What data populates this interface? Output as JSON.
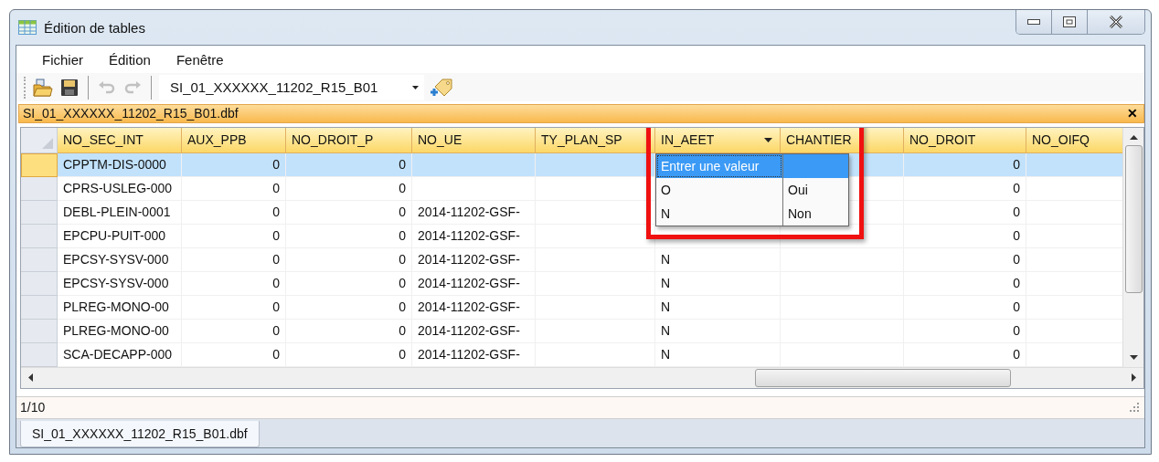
{
  "window": {
    "title": "Édition de tables"
  },
  "menu": [
    {
      "label": "Fichier"
    },
    {
      "label": "Édition"
    },
    {
      "label": "Fenêtre"
    }
  ],
  "toolbar": {
    "buttons": [
      {
        "kind": "open",
        "disabled": false
      },
      {
        "kind": "save",
        "disabled": false
      },
      {
        "kind": "undo",
        "disabled": true
      },
      {
        "kind": "redo",
        "disabled": true
      }
    ],
    "table_select": {
      "value": "SI_01_XXXXXX_11202_R15_B01"
    }
  },
  "document_bar": {
    "title": "SI_01_XXXXXX_11202_R15_B01.dbf",
    "close": "✕"
  },
  "table": {
    "columns": [
      {
        "label": "NO_SEC_INT",
        "kind": "text",
        "filter": false
      },
      {
        "label": "AUX_PPB",
        "kind": "number",
        "filter": false
      },
      {
        "label": "NO_DROIT_P",
        "kind": "number",
        "filter": false
      },
      {
        "label": "NO_UE",
        "kind": "text",
        "filter": false
      },
      {
        "label": "TY_PLAN_SP",
        "kind": "text",
        "filter": false
      },
      {
        "label": "IN_AEET",
        "kind": "text",
        "filter": true
      },
      {
        "label": "CHANTIER",
        "kind": "text",
        "filter": false
      },
      {
        "label": "NO_DROIT",
        "kind": "number",
        "filter": false
      },
      {
        "label": "NO_OIFQ",
        "kind": "text",
        "filter": false
      }
    ],
    "rows": [
      {
        "selected": true,
        "cells": [
          "CPPTM-DIS-0000",
          "0",
          "0",
          "",
          "",
          "",
          "",
          "0",
          ""
        ]
      },
      {
        "selected": false,
        "cells": [
          "CPRS-USLEG-000",
          "0",
          "0",
          "",
          "",
          "",
          "",
          "0",
          ""
        ]
      },
      {
        "selected": false,
        "cells": [
          "DEBL-PLEIN-0001",
          "0",
          "0",
          "2014-11202-GSF-",
          "",
          "",
          "",
          "0",
          ""
        ]
      },
      {
        "selected": false,
        "cells": [
          "EPCPU-PUIT-000",
          "0",
          "0",
          "2014-11202-GSF-",
          "",
          "",
          "",
          "0",
          ""
        ]
      },
      {
        "selected": false,
        "cells": [
          "EPCSY-SYSV-000",
          "0",
          "0",
          "2014-11202-GSF-",
          "",
          "N",
          "",
          "0",
          ""
        ]
      },
      {
        "selected": false,
        "cells": [
          "EPCSY-SYSV-000",
          "0",
          "0",
          "2014-11202-GSF-",
          "",
          "N",
          "",
          "0",
          ""
        ]
      },
      {
        "selected": false,
        "cells": [
          "PLREG-MONO-00",
          "0",
          "0",
          "2014-11202-GSF-",
          "",
          "N",
          "",
          "0",
          ""
        ]
      },
      {
        "selected": false,
        "cells": [
          "PLREG-MONO-00",
          "0",
          "0",
          "2014-11202-GSF-",
          "",
          "N",
          "",
          "0",
          ""
        ]
      },
      {
        "selected": false,
        "cells": [
          "SCA-DECAPP-000",
          "0",
          "0",
          "2014-11202-GSF-",
          "",
          "N",
          "",
          "0",
          ""
        ]
      }
    ],
    "dropdown": [
      {
        "selected": true,
        "code": "Entrer une valeur"
      },
      {
        "selected": false,
        "code": "O",
        "text": "Oui"
      },
      {
        "selected": false,
        "code": "N",
        "text": "Non"
      }
    ]
  },
  "status_bar": {
    "text": "1/10"
  },
  "tabs": [
    {
      "label": "SI_01_XXXXXX_11202_R15_B01.dbf",
      "selected": true
    }
  ]
}
